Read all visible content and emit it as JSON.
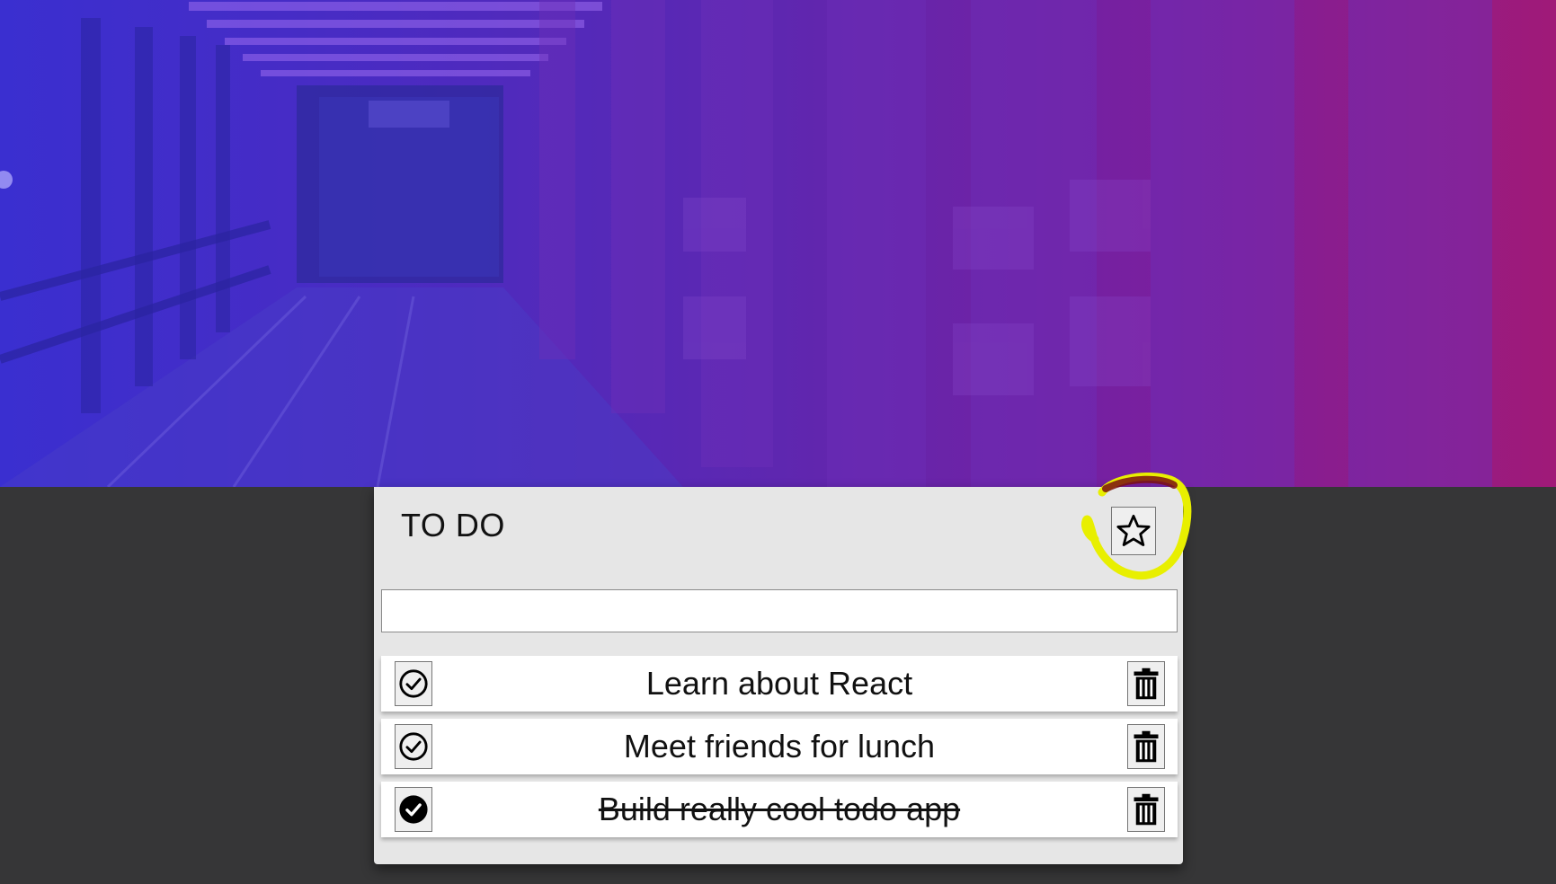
{
  "todo": {
    "title": "TO DO",
    "input_placeholder": "",
    "input_value": "",
    "items": [
      {
        "text": "Learn about React",
        "completed": false
      },
      {
        "text": "Meet friends for lunch",
        "completed": false
      },
      {
        "text": "Build really cool todo app",
        "completed": true
      }
    ]
  },
  "icons": {
    "favorite": "star-icon",
    "check": "check-circle-icon",
    "check_done": "check-circle-filled-icon",
    "delete": "trash-icon"
  },
  "colors": {
    "background": "#363637",
    "card": "#e6e6e6",
    "highlight": "#e8ef00",
    "hero_start": "#3a2fd0",
    "hero_end": "#a01a78"
  }
}
